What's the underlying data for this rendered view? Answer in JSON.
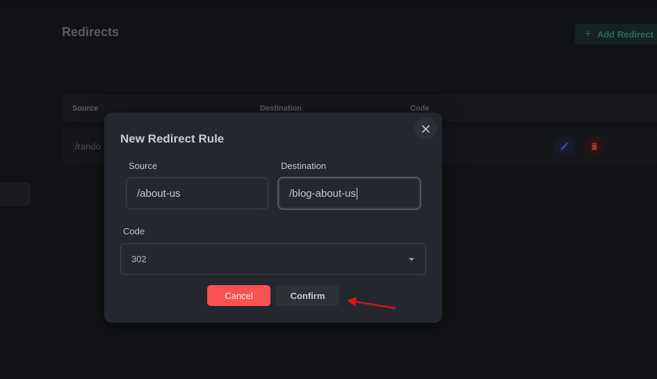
{
  "page": {
    "title": "Redirects",
    "add_button_label": "Add Redirect",
    "table": {
      "columns": [
        "Source",
        "Destination",
        "Code"
      ],
      "rows": [
        {
          "source": "/rando"
        }
      ]
    }
  },
  "modal": {
    "title": "New Redirect Rule",
    "fields": {
      "source": {
        "label": "Source",
        "value": "/about-us"
      },
      "destination": {
        "label": "Destination",
        "value": "/blog-about-us"
      },
      "code": {
        "label": "Code",
        "value": "302"
      }
    },
    "cancel_label": "Cancel",
    "confirm_label": "Confirm"
  },
  "icons": {
    "add": "plus-icon",
    "edit": "pencil-icon",
    "delete": "trash-icon",
    "close": "close-icon",
    "dropdown": "chevron-down-icon"
  },
  "colors": {
    "cancel_button": "#fa5252",
    "add_button_text": "#2a8a74",
    "edit_icon": "#4a57c8",
    "delete_icon": "#d63838",
    "annotation_arrow": "#e01515"
  }
}
